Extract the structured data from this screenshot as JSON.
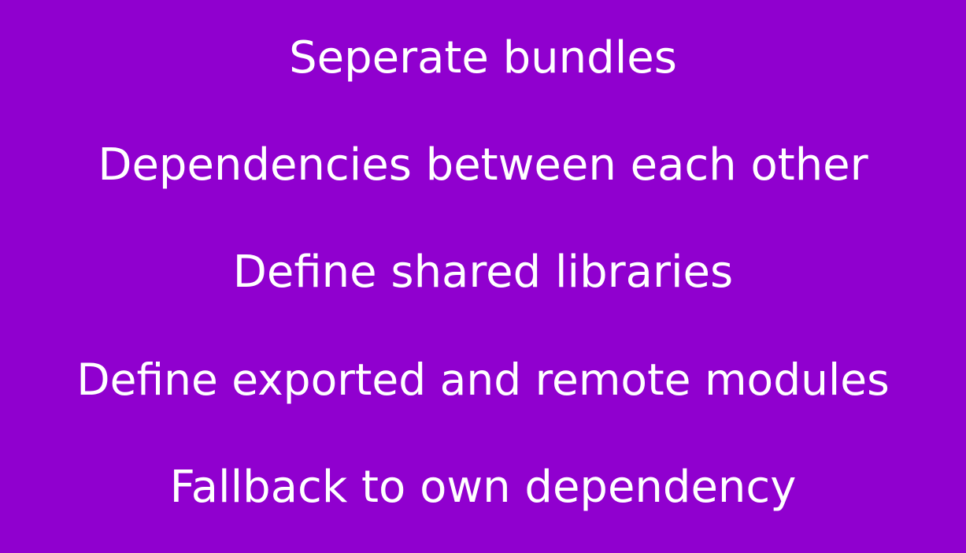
{
  "slide": {
    "background_color": "#9000cf",
    "text_color": "#ffffff",
    "lines": [
      "Seperate bundles",
      "Dependencies between each other",
      "Define shared libraries",
      "Define exported and remote modules",
      "Fallback to own dependency"
    ]
  }
}
